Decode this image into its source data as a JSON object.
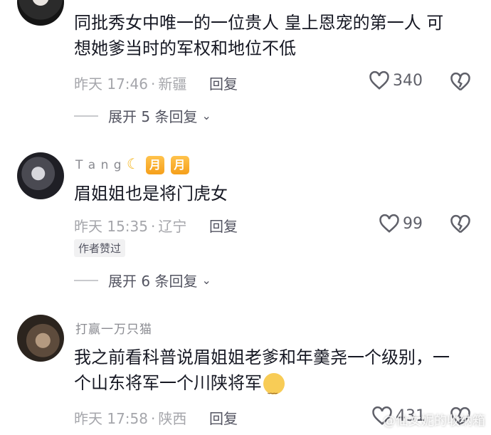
{
  "comments": [
    {
      "username": "",
      "text_line1": "同批秀女中唯一的一位贵人 皇上恩宠的第一人 可",
      "text_line2": "想她爹当时的军权和地位不低",
      "time": "昨天 17:46",
      "location": "新疆",
      "reply_label": "回复",
      "likes": "340",
      "expand_label": "展开 5 条回复"
    },
    {
      "username": "T a n g",
      "level_badges": [
        "月",
        "月"
      ],
      "text_line1": "眉姐姐也是将门虎女",
      "time": "昨天 15:35",
      "location": "辽宁",
      "reply_label": "回复",
      "likes": "99",
      "author_liked": "作者赞过",
      "expand_label": "展开 6 条回复"
    },
    {
      "username": "打赢一万只猫",
      "text_line1": "我之前看科普说眉姐姐老爹和年羹尧一个级别，一",
      "text_line2": "个山东将军一个川陕将军",
      "time": "昨天 17:58",
      "location": "陕西",
      "reply_label": "回复",
      "likes": "431"
    }
  ],
  "watermark": "@仙女妮的收纳箱",
  "icons": {
    "like": "heart-outline-icon",
    "dislike": "broken-heart-icon",
    "expand": "chevron-down-icon",
    "moon": "crescent-moon-icon",
    "emoji": "worried-face-emoji-icon"
  }
}
